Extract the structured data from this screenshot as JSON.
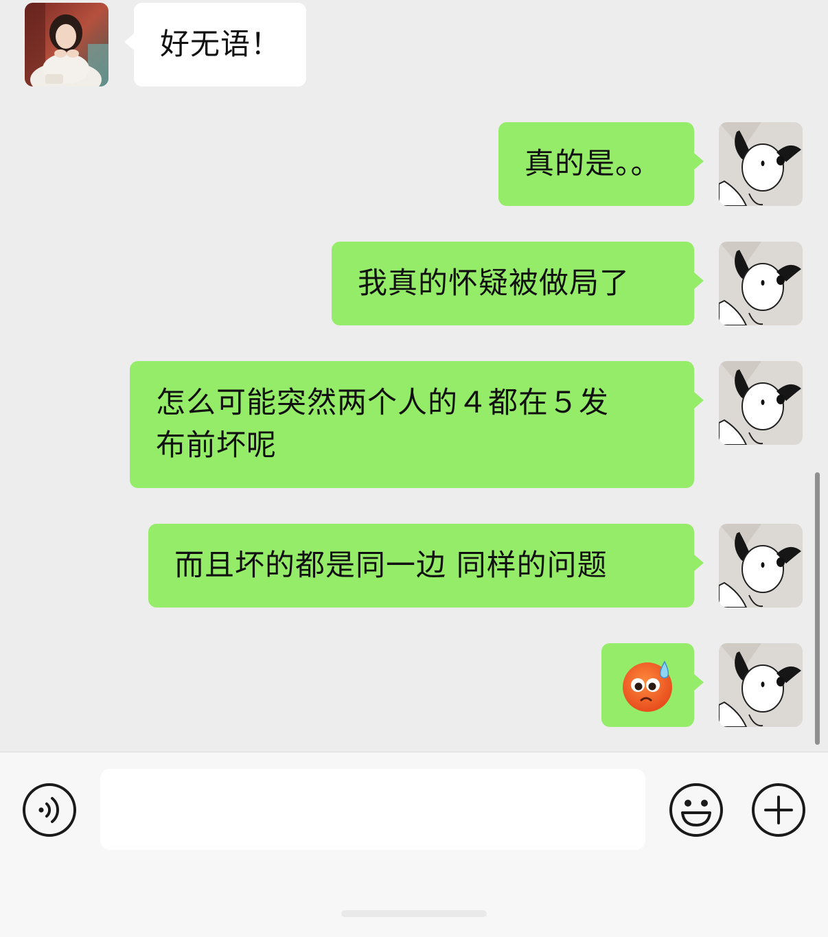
{
  "chat": {
    "messages": [
      {
        "side": "incoming",
        "text": "好无语！"
      },
      {
        "side": "outgoing",
        "text": "真的是。。"
      },
      {
        "side": "outgoing",
        "text": "我真的怀疑被做局了"
      },
      {
        "side": "outgoing",
        "line1": "怎么可能突然两个人的４都在５发",
        "line2": "布前坏呢"
      },
      {
        "side": "outgoing",
        "text": "而且坏的都是同一边 同样的问题"
      },
      {
        "side": "outgoing",
        "emoji": "sweating-pleading-face-emoji"
      }
    ],
    "avatars": {
      "contact": "contact-photo-avatar",
      "self": "snoopy-avatar"
    }
  },
  "input_bar": {
    "voice_icon": "voice-icon",
    "message_value": "",
    "emoji_icon": "emoji-icon",
    "plus_icon": "plus-icon"
  },
  "colors": {
    "chat_background": "#ededed",
    "outgoing_bubble": "#95ec69",
    "incoming_bubble": "#ffffff",
    "input_bar_background": "#f7f7f7",
    "emoji_face": "#f26a1b"
  }
}
